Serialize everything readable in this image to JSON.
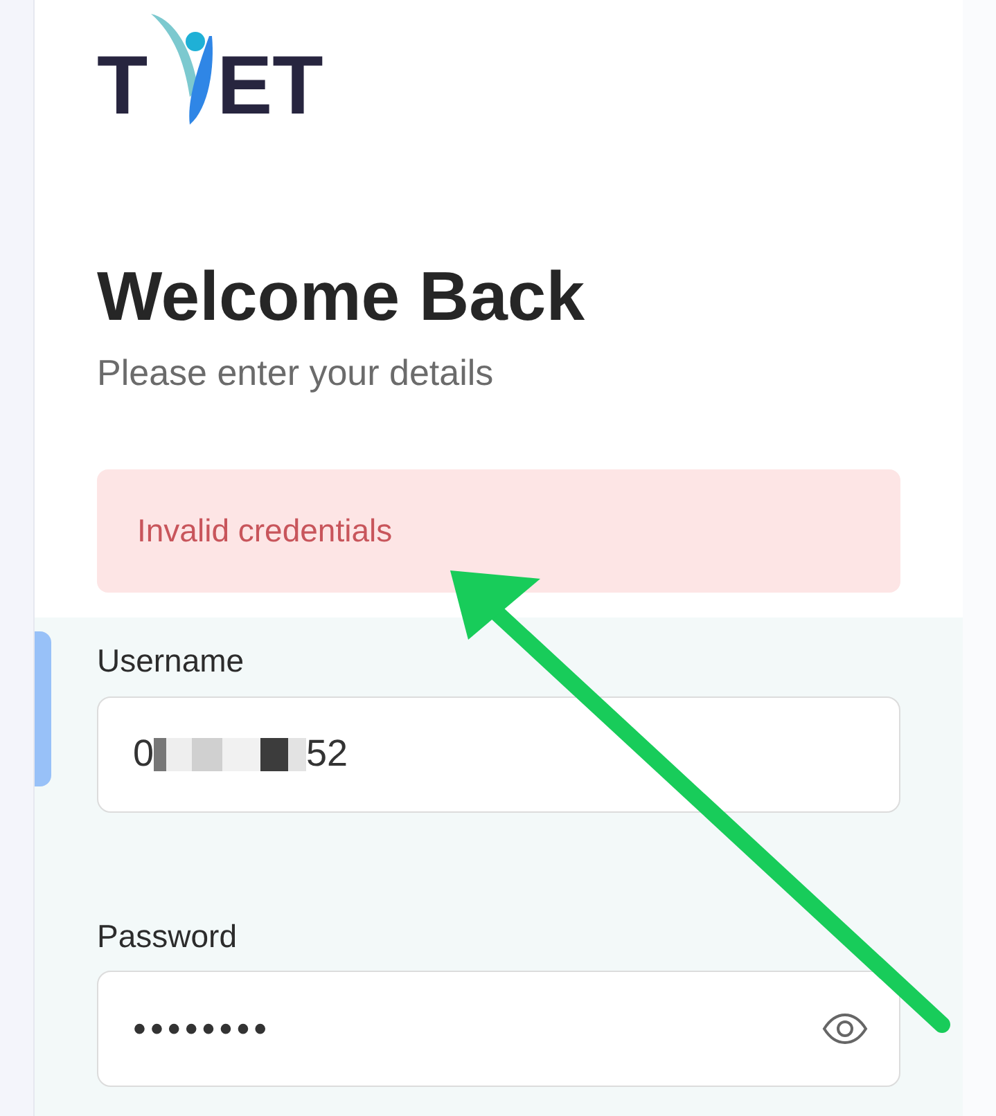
{
  "logo": {
    "text_start": "T",
    "text_end": "ET"
  },
  "heading": "Welcome Back",
  "subheading": "Please enter your details",
  "alert": {
    "text": "Invalid credentials"
  },
  "username": {
    "label": "Username",
    "value_start": "0",
    "value_end": "52",
    "redacted": true
  },
  "password": {
    "label": "Password",
    "value": "••••••••"
  }
}
